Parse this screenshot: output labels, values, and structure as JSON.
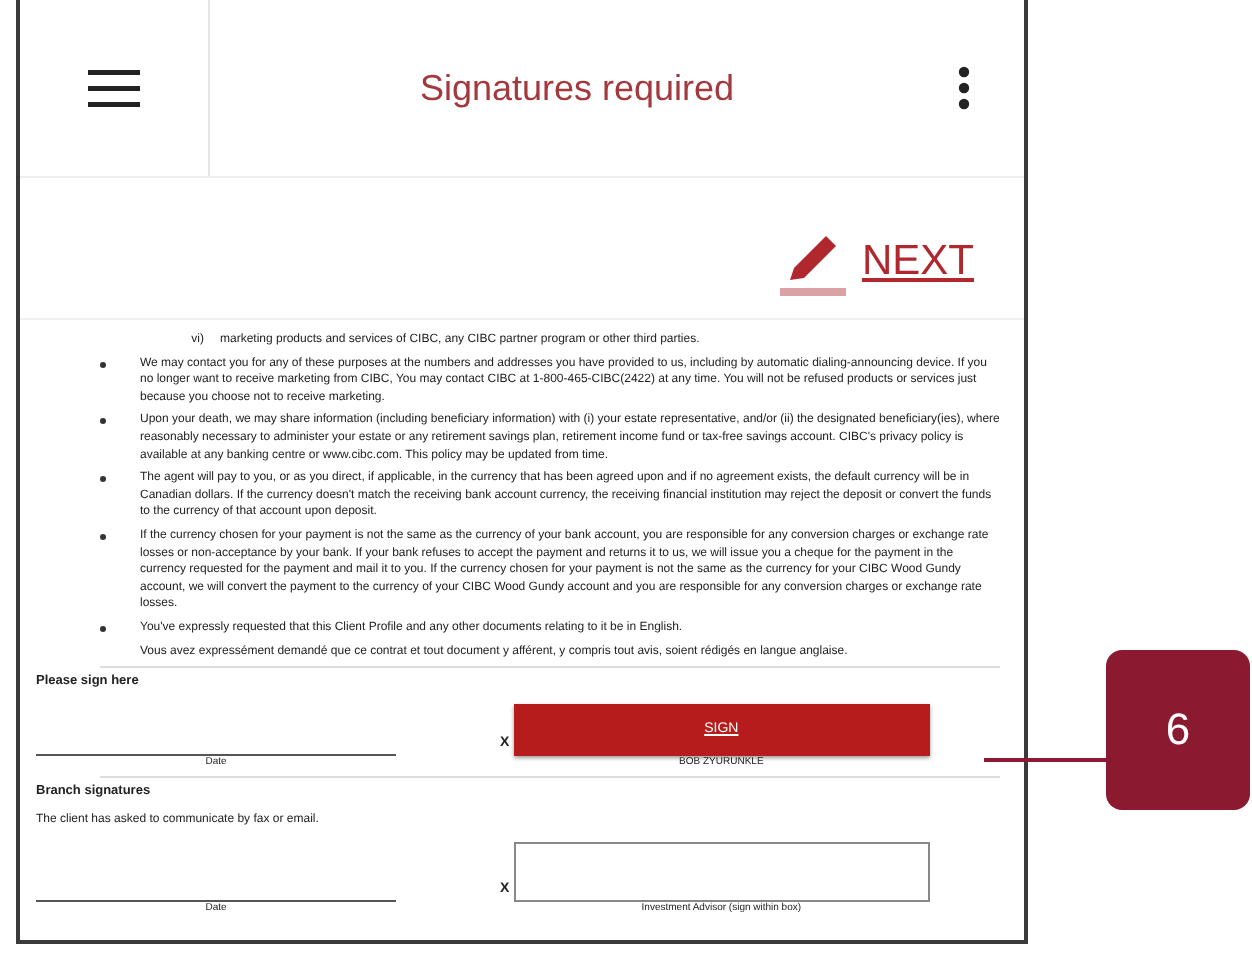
{
  "header": {
    "title": "Signatures required"
  },
  "next_button": {
    "label": "NEXT"
  },
  "document": {
    "intro_item": {
      "marker": "vi)",
      "text": "marketing products and services of CIBC, any CIBC partner program or other third parties."
    },
    "bullets": [
      {
        "paragraphs": [
          "We may contact you for any of these purposes at the numbers and addresses you have provided to us, including by automatic dialing-announcing device.  If you no longer want to receive marketing from CIBC, You may contact CIBC at 1-800-465-CIBC(2422) at any time. You will not be refused products or services just because you choose not to receive marketing."
        ]
      },
      {
        "paragraphs": [
          "Upon your death, we may share information (including beneficiary information) with (i) your estate representative, and/or (ii) the designated beneficiary(ies), where reasonably necessary to administer your estate or any retirement savings plan, retirement income fund or tax-free savings account. CIBC's privacy policy is available at any banking centre or www.cibc.com. This policy may be updated from time."
        ]
      },
      {
        "paragraphs": [
          "The agent will pay to you, or as you direct, if applicable, in the currency that has been agreed upon and if no agreement exists, the default currency will be in Canadian dollars. If the currency doesn't match the receiving bank account currency, the receiving financial institution may reject the deposit or convert the funds to the currency of that account upon deposit."
        ]
      },
      {
        "paragraphs": [
          "If the currency chosen for your payment is not the same as the currency of your bank account, you are responsible for any conversion charges or exchange rate losses or non-acceptance by your bank. If your bank refuses to accept the payment and returns it to us, we will issue you a cheque for the payment in the currency requested for the payment and mail it to you. If the currency chosen for your payment is not the same as the currency for your CIBC Wood Gundy account, we will convert the payment to the currency of your CIBC Wood Gundy account and you are responsible for any conversion charges or exchange rate losses."
        ]
      },
      {
        "paragraphs": [
          "You've expressly requested that this Client Profile and any other documents relating to it be in English.",
          "Vous avez expressément demandé que ce contrat et tout document y afférent, y compris tout avis, soient rédigés en langue anglaise."
        ]
      }
    ],
    "client_signature": {
      "heading": "Please sign here",
      "date_label": "Date",
      "x_mark": "X",
      "sign_button": "SIGN",
      "signer": "BOB ZYURUNKLE"
    },
    "branch_signature": {
      "heading": "Branch signatures",
      "note": "The client has asked to communicate by fax or email.",
      "date_label": "Date",
      "x_mark": "X",
      "advisor_label": "Investment Advisor (sign within box)"
    }
  },
  "callout": {
    "label": "6"
  }
}
